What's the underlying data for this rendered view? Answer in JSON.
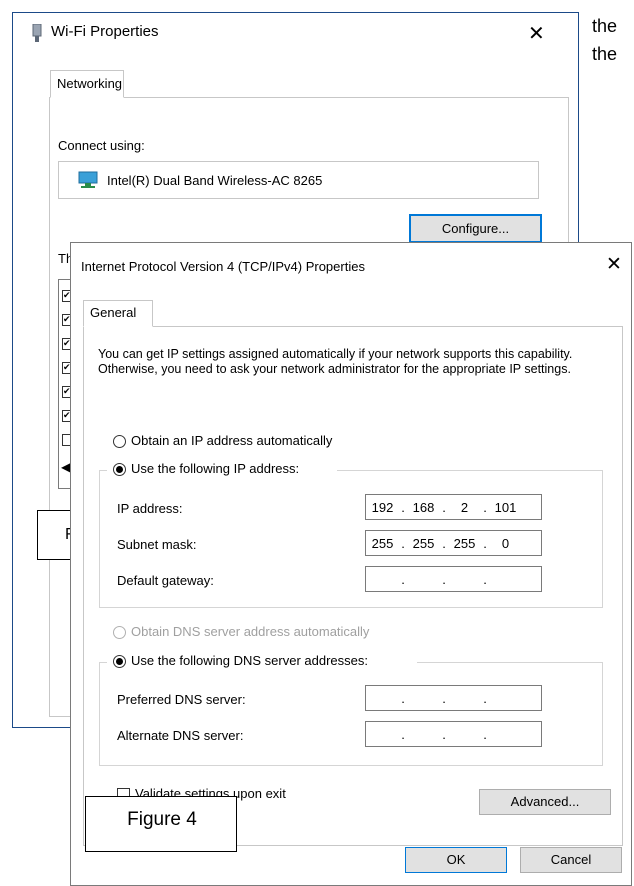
{
  "background": {
    "line1": "the",
    "line2": "the"
  },
  "wifi_window": {
    "title": "Wi-Fi Properties",
    "close_glyph": "✕",
    "tab": "Networking",
    "connect_using_label": "Connect using:",
    "adapter": "Intel(R) Dual Band Wireless-AC 8265",
    "configure_button": "Configure...",
    "list_label_fragment": "Thi",
    "figure_label_fragment": "F"
  },
  "ipv4_dialog": {
    "title": "Internet Protocol Version 4 (TCP/IPv4) Properties",
    "close_glyph": "✕",
    "tab": "General",
    "description": "You can get IP settings assigned automatically if your network supports this capability. Otherwise, you need to ask your network administrator for the appropriate IP settings.",
    "ip_mode": {
      "auto_label": "Obtain an IP address automatically",
      "manual_label": "Use the following IP address:",
      "selected": "manual"
    },
    "ip_fields": {
      "ip_address_label": "IP address:",
      "ip_address": [
        "192",
        "168",
        "2",
        "101"
      ],
      "subnet_label": "Subnet mask:",
      "subnet": [
        "255",
        "255",
        "255",
        "0"
      ],
      "gateway_label": "Default gateway:",
      "gateway": [
        "",
        "",
        "",
        ""
      ]
    },
    "dns_mode": {
      "auto_label": "Obtain DNS server address automatically",
      "manual_label": "Use the following DNS server addresses:",
      "selected": "manual"
    },
    "dns_fields": {
      "preferred_label": "Preferred DNS server:",
      "preferred": [
        "",
        "",
        "",
        ""
      ],
      "alternate_label": "Alternate DNS server:",
      "alternate": [
        "",
        "",
        "",
        ""
      ]
    },
    "validate_label": "Validate settings upon exit",
    "advanced_button": "Advanced...",
    "ok_button": "OK",
    "cancel_button": "Cancel",
    "figure_label": "Figure 4"
  },
  "colors": {
    "accent": "#0078d7",
    "window_border": "#1b4a88"
  }
}
